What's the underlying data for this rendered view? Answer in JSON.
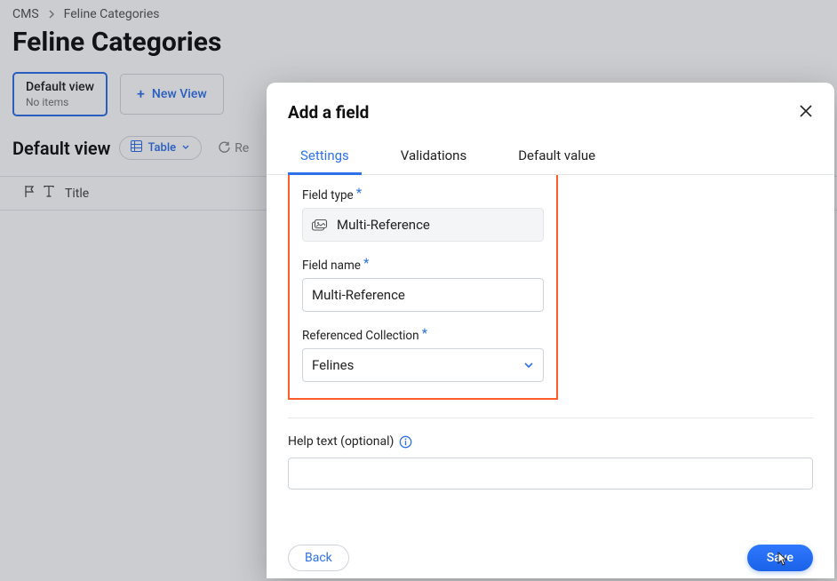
{
  "breadcrumb": {
    "root": "CMS",
    "current": "Feline Categories"
  },
  "page_title": "Feline Categories",
  "views": {
    "default_chip": {
      "title": "Default view",
      "subtitle": "No items"
    },
    "new_view_label": "New View"
  },
  "view_row": {
    "name": "Default view",
    "table_pill": "Table",
    "refresh_hint": "Re"
  },
  "table": {
    "columns": {
      "title": "Title"
    }
  },
  "modal": {
    "title": "Add a field",
    "tabs": {
      "settings": "Settings",
      "validations": "Validations",
      "default_value": "Default value"
    },
    "field_type": {
      "label": "Field type",
      "value": "Multi-Reference"
    },
    "field_name": {
      "label": "Field name",
      "value": "Multi-Reference"
    },
    "ref_collection": {
      "label": "Referenced Collection",
      "value": "Felines"
    },
    "help_text": {
      "label": "Help text (optional)",
      "value": ""
    },
    "buttons": {
      "back": "Back",
      "save": "Save"
    }
  }
}
